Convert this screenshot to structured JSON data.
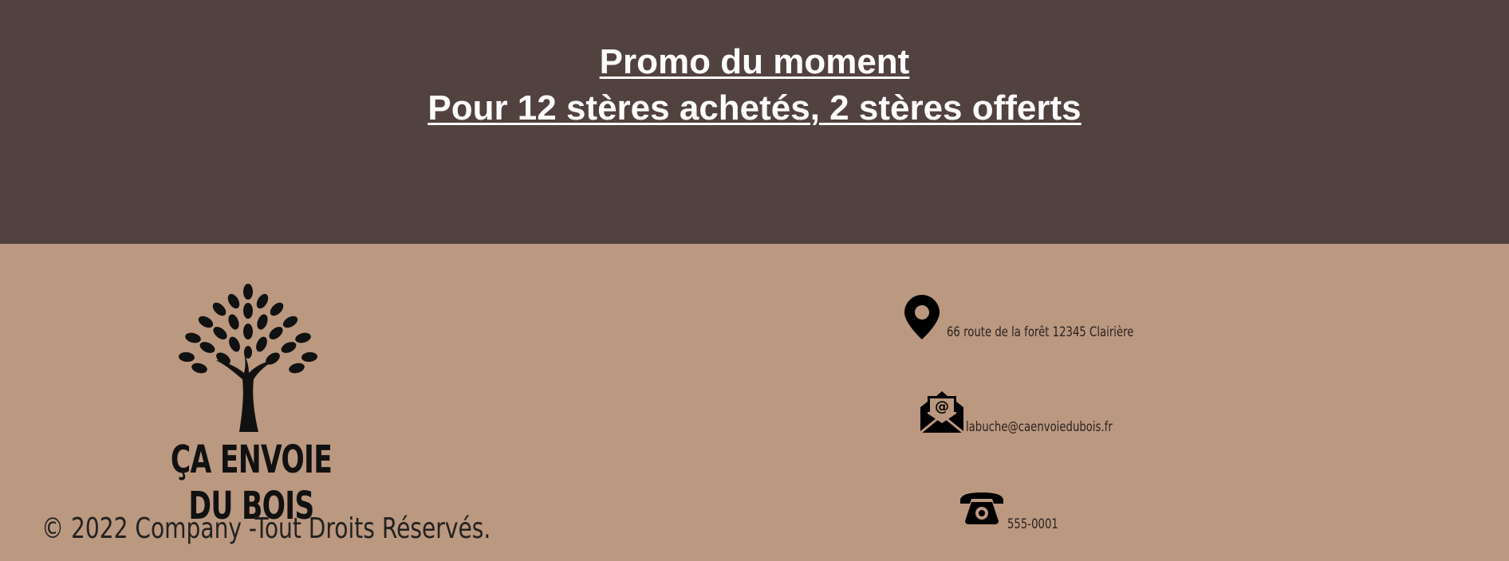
{
  "promo": {
    "title": "Promo du moment",
    "offer": "Pour 12 stères achetés, 2 stères offerts"
  },
  "footer": {
    "brand": "ÇA ENVOIE DU BOIS",
    "copyright": "© 2022 Company -Tout Droits Réservés.",
    "contact": {
      "address": "66 route de la forêt 12345 Clairière",
      "email": "labuche@caenvoiedubois.fr",
      "phone": "555-0001"
    }
  },
  "colors": {
    "promo_background": "#514240",
    "footer_background": "#bb9880",
    "promo_text": "#ffffff"
  },
  "icons": [
    "tree-logo-icon",
    "map-pin-icon",
    "envelope-at-icon",
    "telephone-icon"
  ]
}
